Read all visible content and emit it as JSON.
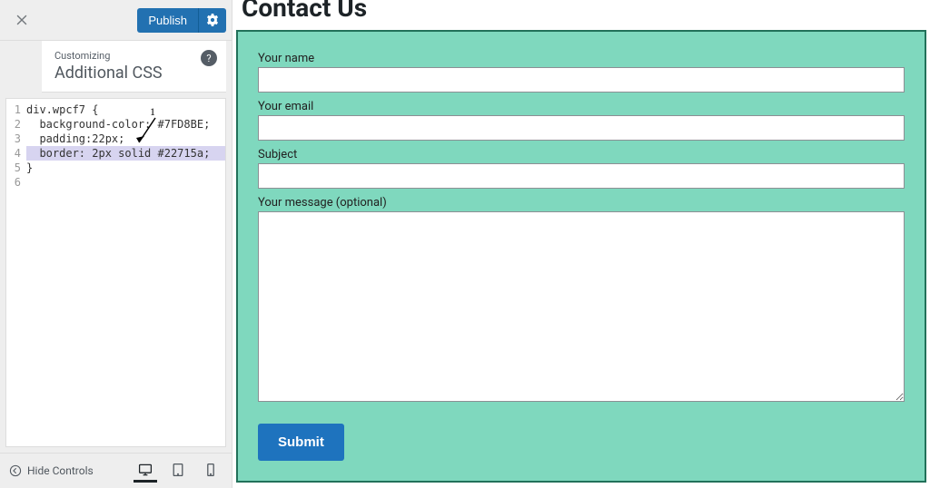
{
  "sidebar": {
    "publish_label": "Publish",
    "customizing_label": "Customizing",
    "panel_title": "Additional CSS",
    "help_symbol": "?",
    "code": {
      "lines": [
        {
          "n": "1",
          "text": "div.wpcf7 {"
        },
        {
          "n": "2",
          "text": "  background-color: #7FD8BE;"
        },
        {
          "n": "3",
          "text": "  padding:22px;"
        },
        {
          "n": "4",
          "text": "  border: 2px solid #22715a;",
          "hl": true
        },
        {
          "n": "5",
          "text": "}"
        },
        {
          "n": "6",
          "text": ""
        }
      ]
    },
    "hide_controls_label": "Hide Controls",
    "annotation_text": "1"
  },
  "preview": {
    "page_title": "Contact Us",
    "form": {
      "name_label": "Your name",
      "email_label": "Your email",
      "subject_label": "Subject",
      "message_label": "Your message (optional)",
      "submit_label": "Submit"
    },
    "colors": {
      "bg": "#7FD8BE",
      "border": "#22715a",
      "submit_bg": "#1e73be"
    }
  },
  "ext_handle_label": "•••"
}
